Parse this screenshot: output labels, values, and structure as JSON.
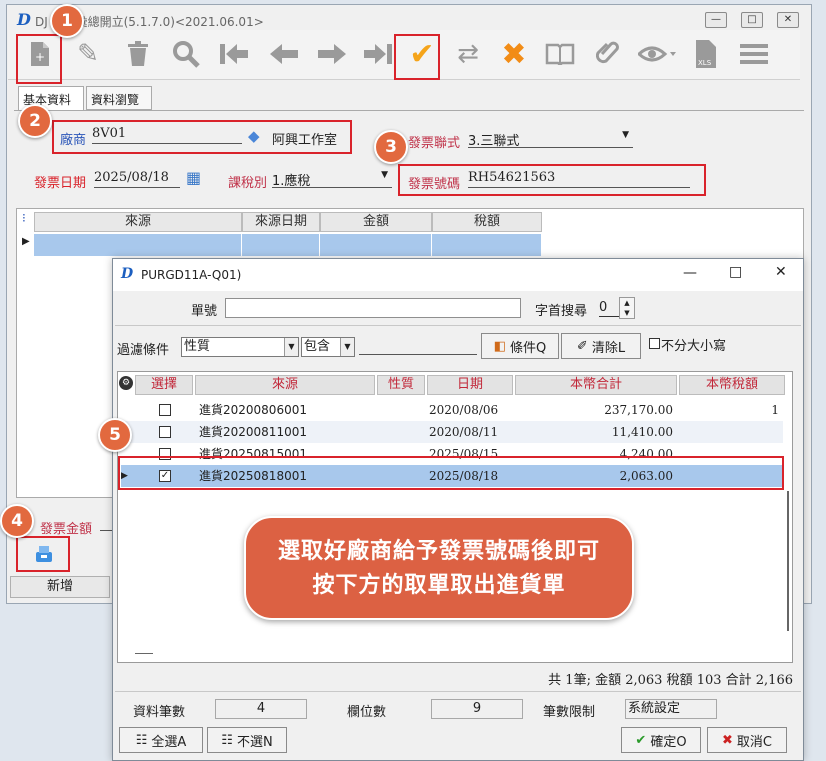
{
  "main_window": {
    "title": "DJ 發票彙總開立(5.1.7.0)<2021.06.01>",
    "logo": "D",
    "tabs": [
      "基本資料",
      "資料瀏覽"
    ],
    "toolbar_icons": [
      "new-doc-icon",
      "edit-icon",
      "delete-icon",
      "search-icon",
      "first-icon",
      "prev-icon",
      "next-icon",
      "last-icon",
      "confirm-check-icon",
      "refresh-icon",
      "cancel-x-icon",
      "book-icon",
      "attach-icon",
      "view-icon",
      "xls-icon",
      "menu-icon"
    ],
    "form": {
      "vendor_label": "廠商",
      "vendor_code": "8V01",
      "vendor_name": "阿興工作室",
      "invoice_type_label": "發票聯式",
      "invoice_type_value": "3.三聯式",
      "invoice_date_label": "發票日期",
      "invoice_date_value": "2025/08/18",
      "tax_type_label": "課稅別",
      "tax_type_value": "1.應稅",
      "invoice_no_label": "發票號碼",
      "invoice_no_value": "RH54621563"
    },
    "grid_headers": [
      "來源",
      "來源日期",
      "金額",
      "稅額"
    ],
    "amount_label": "發票金額",
    "bottom_button": "新增"
  },
  "dialog": {
    "title": "PURGD11A-Q01)",
    "order_no_label": "單號",
    "order_no_value": "",
    "prefix_search_label": "字首搜尋",
    "prefix_search_value": "0",
    "filter_label": "過濾條件",
    "filter_field": "性質",
    "filter_op": "包含",
    "filter_value": "",
    "condition_button": "條件Q",
    "clear_button": "清除L",
    "ignore_case_label": "不分大小寫",
    "columns": [
      "選擇",
      "來源",
      "性質",
      "日期",
      "本幣合計",
      "本幣稅額"
    ],
    "rows": [
      {
        "checked": false,
        "source": "進貨20200806001",
        "nature": "",
        "date": "2020/08/06",
        "total": "237,170.00",
        "tax": "1"
      },
      {
        "checked": false,
        "source": "進貨20200811001",
        "nature": "",
        "date": "2020/08/11",
        "total": "11,410.00",
        "tax": ""
      },
      {
        "checked": false,
        "source": "進貨20250815001",
        "nature": "",
        "date": "2025/08/15",
        "total": "4,240.00",
        "tax": ""
      },
      {
        "checked": true,
        "source": "進貨20250818001",
        "nature": "",
        "date": "2025/08/18",
        "total": "2,063.00",
        "tax": ""
      }
    ],
    "summary": "共 1筆; 金額 2,063 稅額 103  合計 2,166",
    "record_count_label": "資料筆數",
    "record_count_value": "4",
    "field_count_label": "欄位數",
    "field_count_value": "9",
    "limit_label": "筆數限制",
    "limit_value": "系統設定",
    "select_all_button": "全選A",
    "deselect_button": "不選N",
    "confirm_button": "確定O",
    "cancel_button": "取消C"
  },
  "annotations": {
    "steps": [
      "1",
      "2",
      "3",
      "4",
      "5"
    ],
    "callout_line1": "選取好廠商給予發票號碼後即可",
    "callout_line2": "按下方的取單取出進貨單"
  },
  "colors": {
    "highlight_red": "#d9232b",
    "step_orange": "#e2693f",
    "selection_blue": "#a8c8ec",
    "check_orange": "#f5a41a"
  }
}
